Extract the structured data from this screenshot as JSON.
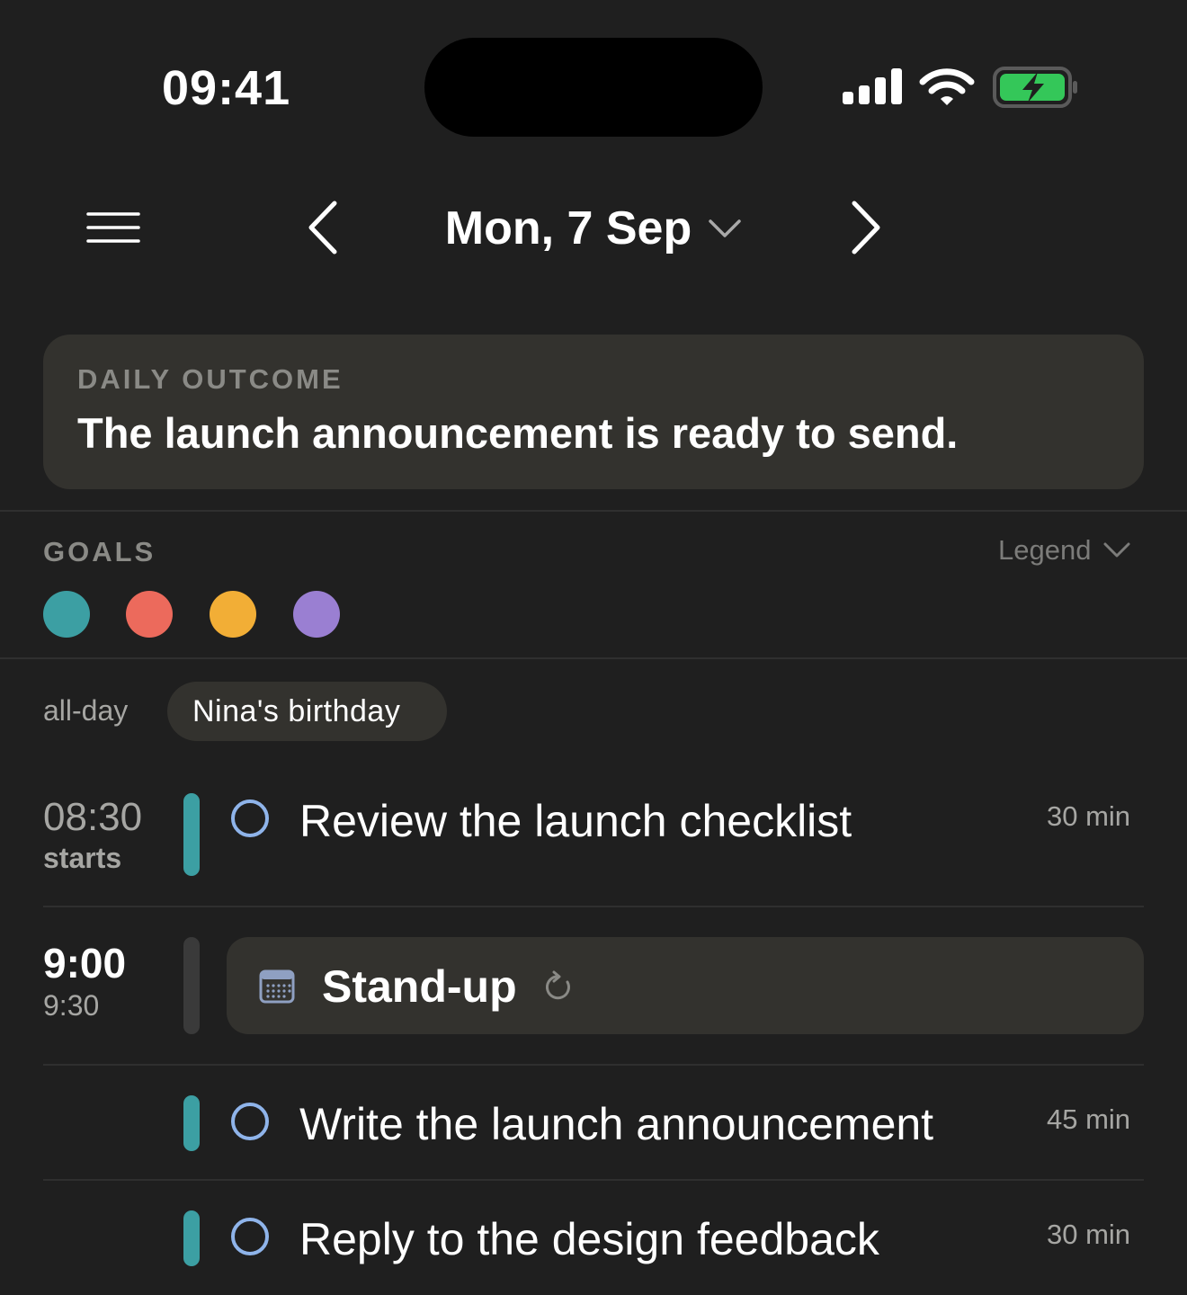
{
  "status_bar": {
    "time": "09:41"
  },
  "nav": {
    "date_label": "Mon, 7 Sep"
  },
  "outcome": {
    "label": "DAILY OUTCOME",
    "text": "The launch announcement is ready to send."
  },
  "goals": {
    "label": "GOALS",
    "legend_label": "Legend",
    "colors": [
      "#3c9fa3",
      "#ec6a5c",
      "#f2ae36",
      "#9a7fd2"
    ]
  },
  "all_day": {
    "label": "all-day",
    "event": "Nina's birthday"
  },
  "schedule": {
    "task1": {
      "time": "08:30",
      "sub": "starts",
      "title": "Review the launch checklist",
      "duration": "30 min"
    },
    "event": {
      "start": "9:00",
      "end": "9:30",
      "title": "Stand-up"
    },
    "task2": {
      "title": "Write the launch announcement",
      "duration": "45 min"
    },
    "task3": {
      "title": "Reply to the design feedback",
      "duration": "30 min"
    }
  },
  "colors": {
    "background": "#1f1f1f",
    "card": "#33322e",
    "task_bar": "#3c9fa3",
    "event_bar": "#3a3a3a",
    "checkbox": "#8fb4ea",
    "battery": "#34c759"
  }
}
